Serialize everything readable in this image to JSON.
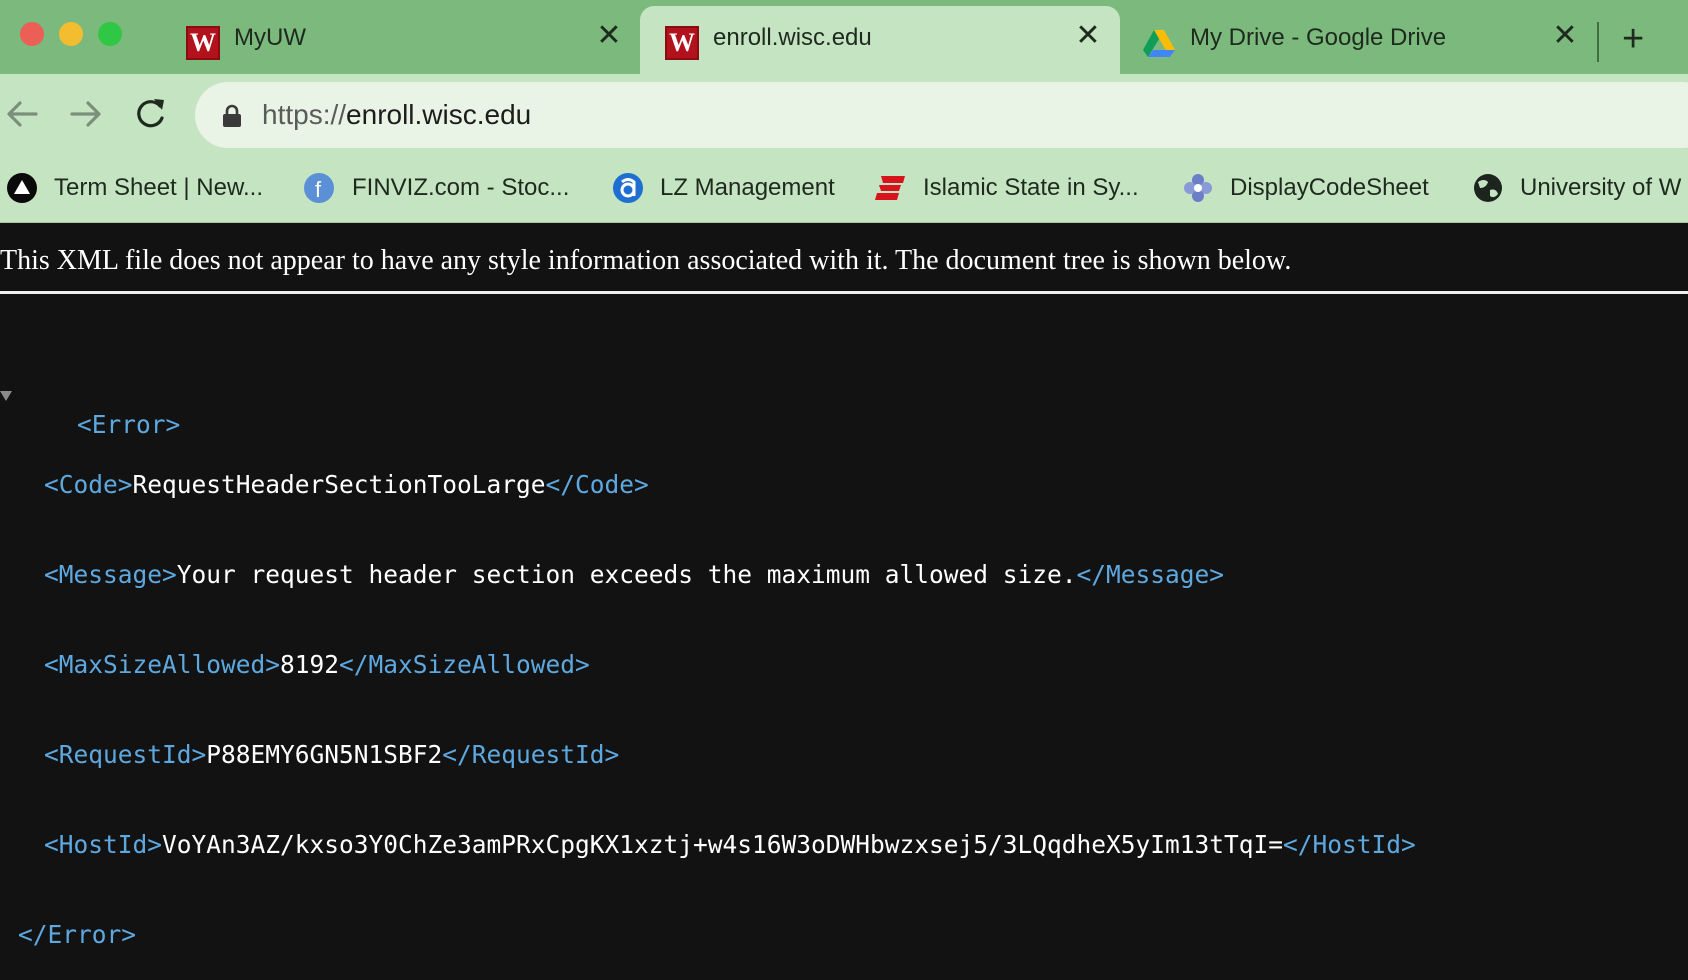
{
  "tabs": [
    {
      "title": "MyUW",
      "close": "✕",
      "active": false,
      "favicon_letter": "W"
    },
    {
      "title": "enroll.wisc.edu",
      "close": "✕",
      "active": true,
      "favicon_letter": "W"
    },
    {
      "title": "My Drive - Google Drive",
      "close": "✕",
      "active": false
    }
  ],
  "new_tab_label": "+",
  "omnibox": {
    "scheme": "https://",
    "host": "enroll.wisc.edu"
  },
  "bookmarks": [
    {
      "label": "Term Sheet | New...",
      "icon": "black-circle-triangle-icon"
    },
    {
      "label": "FINVIZ.com - Stoc...",
      "icon": "finviz-icon"
    },
    {
      "label": "LZ Management",
      "icon": "lz-icon"
    },
    {
      "label": "Islamic State in Sy...",
      "icon": "espn-icon"
    },
    {
      "label": "DisplayCodeSheet",
      "icon": "flower-icon"
    },
    {
      "label": "University of W",
      "icon": "globe-icon"
    }
  ],
  "page": {
    "notice": "This XML file does not appear to have any style information associated with it. The document tree is shown below.",
    "xml": {
      "root_open": "<Error>",
      "root_close": "</Error>",
      "code": {
        "open": "<Code>",
        "value": "RequestHeaderSectionTooLarge",
        "close": "</Code>"
      },
      "message": {
        "open": "<Message>",
        "value": "Your request header section exceeds the maximum allowed size.",
        "close": "</Message>"
      },
      "max_size": {
        "open": "<MaxSizeAllowed>",
        "value": "8192",
        "close": "</MaxSizeAllowed>"
      },
      "request_id": {
        "open": "<RequestId>",
        "value": "P88EMY6GN5N1SBF2",
        "close": "</RequestId>"
      },
      "host_id": {
        "open": "<HostId>",
        "value": "VoYAn3AZ/kxso3Y0ChZe3amPRxCpgKX1xztj+w4s16W3oDWHbwzxsej5/3LQqdheX5yIm13tTqI=",
        "close": "</HostId>"
      }
    }
  },
  "colors": {
    "tabstrip": "#7bb97d",
    "toolbar": "#c5e4c2",
    "xml_tag": "#5ea8e0",
    "page_bg": "#121212"
  }
}
